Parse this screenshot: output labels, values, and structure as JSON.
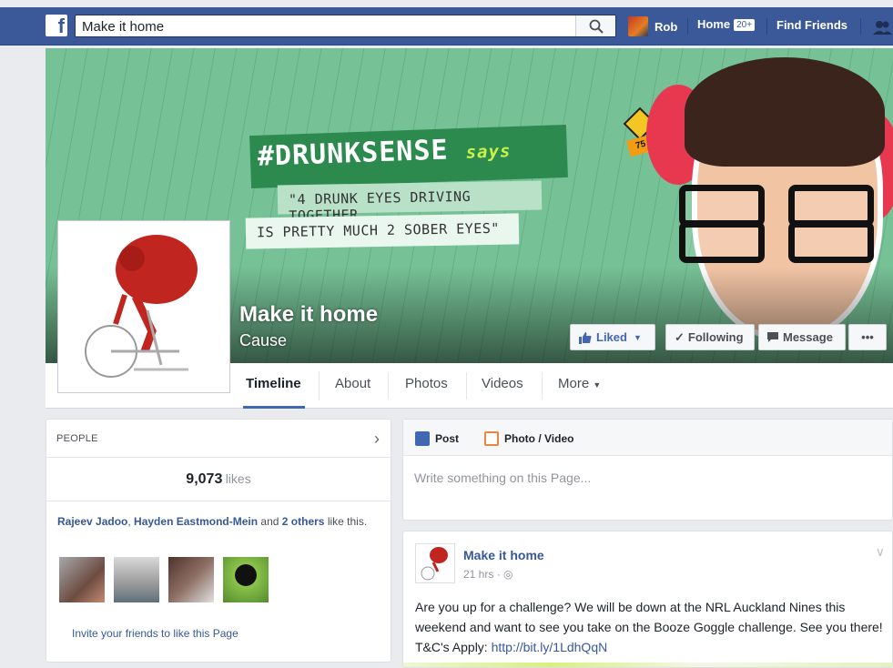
{
  "topbar": {
    "logo_letter": "f",
    "search_value": "Make it home",
    "user_name": "Rob",
    "home_label": "Home",
    "home_badge": "20+",
    "find_friends_label": "Find Friends",
    "brand_color": "#3b5998"
  },
  "cover": {
    "hashtag": "#DRUNKSENSE",
    "says": "says",
    "line1": "\"4 DRUNK EYES DRIVING TOGETHER",
    "line2": "IS PRETTY MUCH 2 SOBER EYES\"",
    "speed_sign": "75"
  },
  "page": {
    "name": "Make it home",
    "category": "Cause"
  },
  "actions": {
    "liked": "Liked",
    "following": "Following",
    "message": "Message",
    "more": "•••"
  },
  "tabs": [
    {
      "label": "Timeline"
    },
    {
      "label": "About"
    },
    {
      "label": "Photos"
    },
    {
      "label": "Videos"
    },
    {
      "label": "More"
    }
  ],
  "people": {
    "title": "PEOPLE",
    "likes_count": "9,073",
    "likes_word": "likes",
    "friend1": "Rajeev Jadoo",
    "friend2": "Hayden Eastmond-Mein",
    "and": "and",
    "others": "2 others",
    "suffix": "like this.",
    "invite": "Invite your friends to like this Page"
  },
  "composer": {
    "post_tab": "Post",
    "photo_tab": "Photo / Video",
    "placeholder": "Write something on this Page..."
  },
  "post": {
    "author": "Make it home",
    "time": "21 hrs",
    "body": "Are you up for a challenge? We will be down at the NRL Auckland Nines this weekend and want to see you take on the Booze Goggle challenge. See you there! T&C's Apply:",
    "link": "http://bit.ly/1LdhQqN"
  }
}
